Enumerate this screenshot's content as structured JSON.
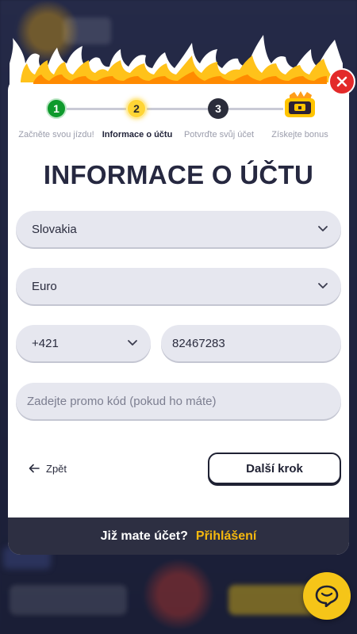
{
  "steps": [
    {
      "number": "1",
      "label": "Začněte svou jízdu!",
      "state": "done"
    },
    {
      "number": "2",
      "label": "Informace o účtu",
      "state": "active"
    },
    {
      "number": "3",
      "label": "Potvrďte svůj účet",
      "state": "upcoming"
    },
    {
      "number": "",
      "label": "Získejte bonus",
      "icon": "treasure-chest-icon"
    }
  ],
  "form": {
    "title": "INFORMACE O ÚČTU",
    "country": "Slovakia",
    "currency": "Euro",
    "phone_code": "+421",
    "phone_number": "82467283",
    "promo_placeholder": "Zadejte promo kód (pokud ho máte)"
  },
  "actions": {
    "back_label": "Zpět",
    "next_label": "Další krok"
  },
  "footer": {
    "question": "Již mate účet?",
    "login_label": "Přihlášení"
  },
  "colors": {
    "accent_yellow": "#ffd535",
    "step_done_green": "#0e9a2c",
    "close_red": "#e32a2a",
    "footer_bg": "#2d2f42",
    "login_link": "#f5b80e",
    "chat_button": "#f5c518"
  }
}
